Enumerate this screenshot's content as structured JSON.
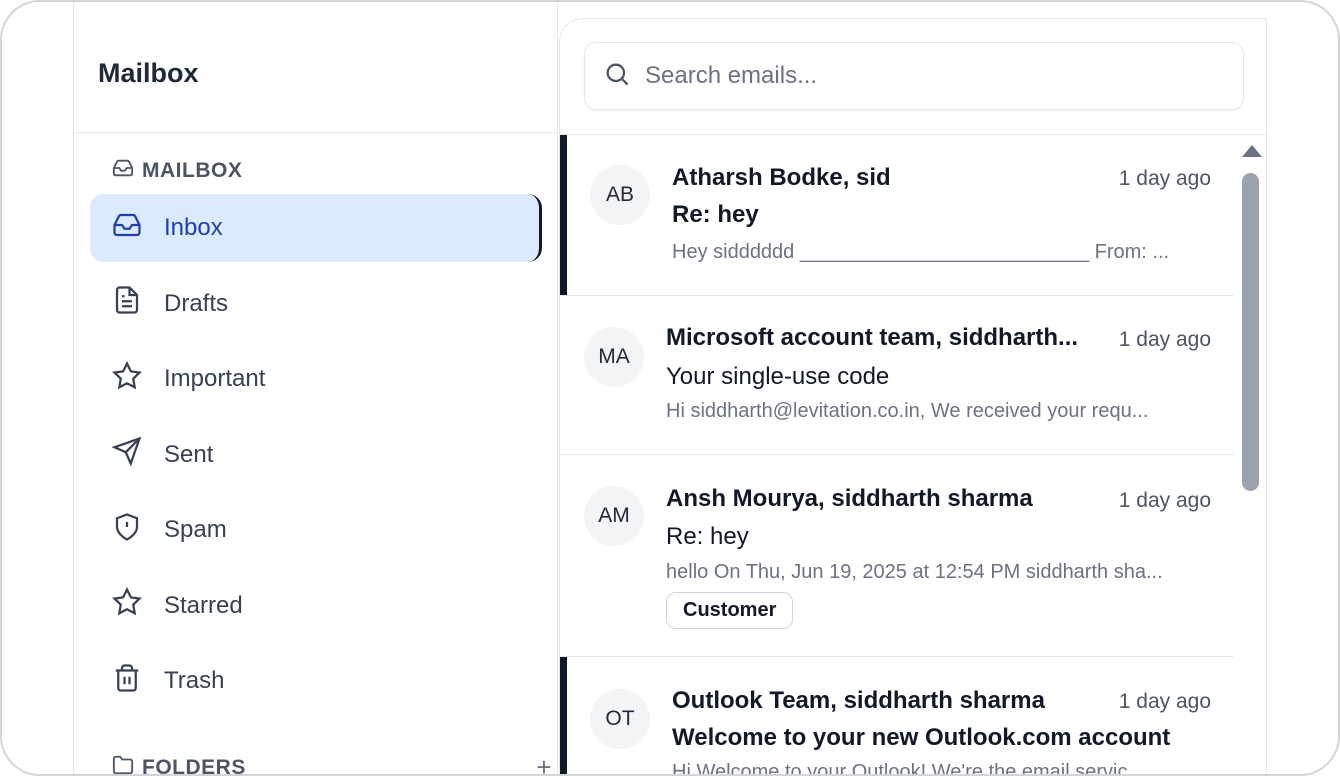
{
  "sidebar": {
    "title": "Mailbox",
    "section_label": "MAILBOX",
    "items": [
      {
        "label": "Inbox",
        "icon": "inbox-icon",
        "active": true
      },
      {
        "label": "Drafts",
        "icon": "file-icon"
      },
      {
        "label": "Important",
        "icon": "star-icon"
      },
      {
        "label": "Sent",
        "icon": "send-icon"
      },
      {
        "label": "Spam",
        "icon": "shield-icon"
      },
      {
        "label": "Starred",
        "icon": "star-icon"
      },
      {
        "label": "Trash",
        "icon": "trash-icon"
      }
    ],
    "folders_label": "FOLDERS",
    "folders_add": "+"
  },
  "search": {
    "placeholder": "Search emails..."
  },
  "emails": [
    {
      "initials": "AB",
      "sender": "Atharsh Bodke, sid",
      "time": "1 day ago",
      "subject": "Re: hey",
      "preview": "Hey sidddddd __________________________ From: ...",
      "unread": true
    },
    {
      "initials": "MA",
      "sender": "Microsoft account team, siddharth...",
      "time": "1 day ago",
      "subject": "Your single-use code",
      "preview": "Hi siddharth@levitation.co.in, We received your requ...",
      "unread": false
    },
    {
      "initials": "AM",
      "sender": "Ansh Mourya, siddharth sharma",
      "time": "1 day ago",
      "subject": "Re: hey",
      "preview": "hello On Thu, Jun 19, 2025 at 12:54 PM siddharth sha...",
      "tag": "Customer",
      "unread": false
    },
    {
      "initials": "OT",
      "sender": "Outlook Team, siddharth sharma",
      "time": "1 day ago",
      "subject": "Welcome to your new Outlook.com account",
      "preview": "Hi Welcome to your Outlook! We're the email servic...",
      "unread": true
    }
  ],
  "colors": {
    "active_bg": "#dbeafe",
    "active_text": "#1e40af",
    "unread_bar": "#111827"
  }
}
